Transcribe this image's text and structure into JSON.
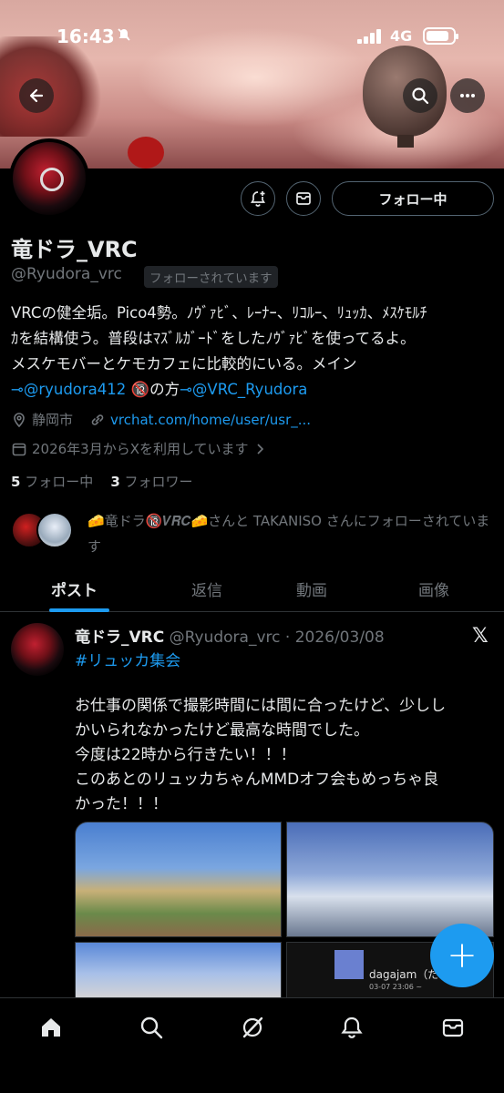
{
  "status_bar": {
    "time": "16:43",
    "network": "4G"
  },
  "header": {
    "back_icon": "arrow-left-icon",
    "search_icon": "search-icon",
    "more_icon": "more-icon"
  },
  "profile": {
    "display_name": "竜ドラ_VRC",
    "handle": "@Ryudora_vrc",
    "follows_you_badge": "フォローされています",
    "follow_button_label": "フォロー中",
    "bio_line1": "VRCの健全垢。Pico4勢。ﾉｳﾞｧﾋﾞ、ﾚｰﾅｰ、ﾘｺﾙｰ、ﾘｭｯｶ、ﾒｽｹﾓﾙﾁ",
    "bio_line2": "ｶを結構使う。普段はﾏｽﾞﾙｶﾞｰﾄﾞをしたﾉｳﾞｧﾋﾞを使ってるよ。",
    "bio_line3": "メスケモバーとケモカフェに比較的にいる。メイン",
    "bio_line4_link1": "@ryudora412",
    "bio_line4_mid": " 🔞の方",
    "bio_line4_link2": "@VRC_Ryudora",
    "location": "静岡市",
    "website": "vrchat.com/home/user/usr_...",
    "joined": "2026年3月からXを利用しています",
    "following_count": "5",
    "following_label": "フォロー中",
    "followers_count": "3",
    "followers_label": "フォロワー",
    "mutual_text": "🧀竜ドラ🔞𝑽𝑹𝑪🧀さんと TAKANISO さんにフォローされています"
  },
  "tabs": [
    {
      "label": "ポスト",
      "active": true
    },
    {
      "label": "返信",
      "active": false
    },
    {
      "label": "動画",
      "active": false
    },
    {
      "label": "画像",
      "active": false
    }
  ],
  "post": {
    "author": "竜ドラ_VRC",
    "handle_date": "@Ryudora_vrc · 2026/03/08",
    "hashtag": "#リュッカ集会",
    "line1": "お仕事の関係で撮影時間には間に合ったけど、少しし",
    "line2": "かいられなかったけど最高な時間でした。",
    "line3": "今度は22時から行きたい！！！",
    "line4": "このあとのリュッカちゃんMMDオフ会もめっちゃ良",
    "line5": "かった！！！",
    "media4_name": "dagajam（だ",
    "media4_sub": "03-07 23:06 ~"
  },
  "fab_label": "+",
  "bottom_nav": [
    "home-icon",
    "search-icon",
    "grok-icon",
    "notifications-icon",
    "messages-icon"
  ]
}
